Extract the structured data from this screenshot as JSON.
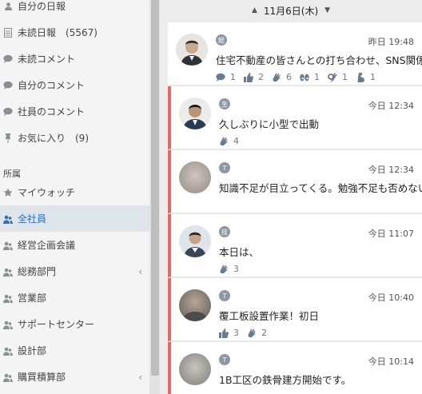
{
  "sidebar": {
    "items": [
      {
        "label": "自分の日報",
        "icon": "user-icon"
      },
      {
        "label": "未読日報　(5567)",
        "icon": "document-icon"
      },
      {
        "label": "未読コメント",
        "icon": "comment-icon"
      },
      {
        "label": "自分のコメント",
        "icon": "comment-icon"
      },
      {
        "label": "社員のコメント",
        "icon": "comment-icon"
      },
      {
        "label": "お気に入り　(9)",
        "icon": "pin-icon"
      }
    ],
    "section_title": "所属",
    "groups": [
      {
        "label": "マイウォッチ",
        "icon": "star-icon",
        "chevron": false,
        "active": false
      },
      {
        "label": "全社員",
        "icon": "users-icon",
        "chevron": false,
        "active": true
      },
      {
        "label": "経営企画会議",
        "icon": "users-icon",
        "chevron": false,
        "active": false
      },
      {
        "label": "総務部門",
        "icon": "users-icon",
        "chevron": true,
        "active": false
      },
      {
        "label": "営業部",
        "icon": "users-icon",
        "chevron": false,
        "active": false
      },
      {
        "label": "サポートセンター",
        "icon": "users-icon",
        "chevron": false,
        "active": false
      },
      {
        "label": "設計部",
        "icon": "users-icon",
        "chevron": false,
        "active": false
      },
      {
        "label": "購買積算部",
        "icon": "users-icon",
        "chevron": true,
        "active": false
      }
    ],
    "chevron_glyph": "‹"
  },
  "feed": {
    "date": "11月6日(木)",
    "prev_glyph": "▲",
    "next_glyph": "▼",
    "posts": [
      {
        "badge": "総",
        "time": "昨日 19:48",
        "title": "住宅不動産の皆さんとの打ち合わせ、SNS関係",
        "unread": false,
        "stats": [
          {
            "icon": "comment-icon",
            "value": "1"
          },
          {
            "icon": "thumbs-up-icon",
            "value": "2"
          },
          {
            "icon": "clap-icon",
            "value": "6"
          },
          {
            "icon": "eyes-icon",
            "value": "1"
          },
          {
            "icon": "ok-icon",
            "value": "1"
          },
          {
            "icon": "flex-icon",
            "value": "1"
          }
        ]
      },
      {
        "badge": "生",
        "time": "今日 12:34",
        "title": "久しぶりに小型で出動",
        "unread": true,
        "stats": [
          {
            "icon": "clap-icon",
            "value": "4"
          }
        ]
      },
      {
        "badge": "T",
        "time": "今日 12:34",
        "title": "知識不足が目立ってくる。勉強不足も否めない",
        "unread": true,
        "stats": []
      },
      {
        "badge": "技",
        "time": "今日 11:07",
        "title": "本日は、",
        "unread": true,
        "stats": [
          {
            "icon": "clap-icon",
            "value": "3"
          }
        ]
      },
      {
        "badge": "T",
        "time": "今日 10:40",
        "title": "覆工板設置作業！初日",
        "unread": true,
        "stats": [
          {
            "icon": "thumbs-up-icon",
            "value": "3"
          },
          {
            "icon": "clap-icon",
            "value": "2"
          }
        ]
      },
      {
        "badge": "T",
        "time": "今日 10:14",
        "title": "1B工区の鉄骨建方開始です。",
        "unread": true,
        "stats": []
      }
    ]
  }
}
